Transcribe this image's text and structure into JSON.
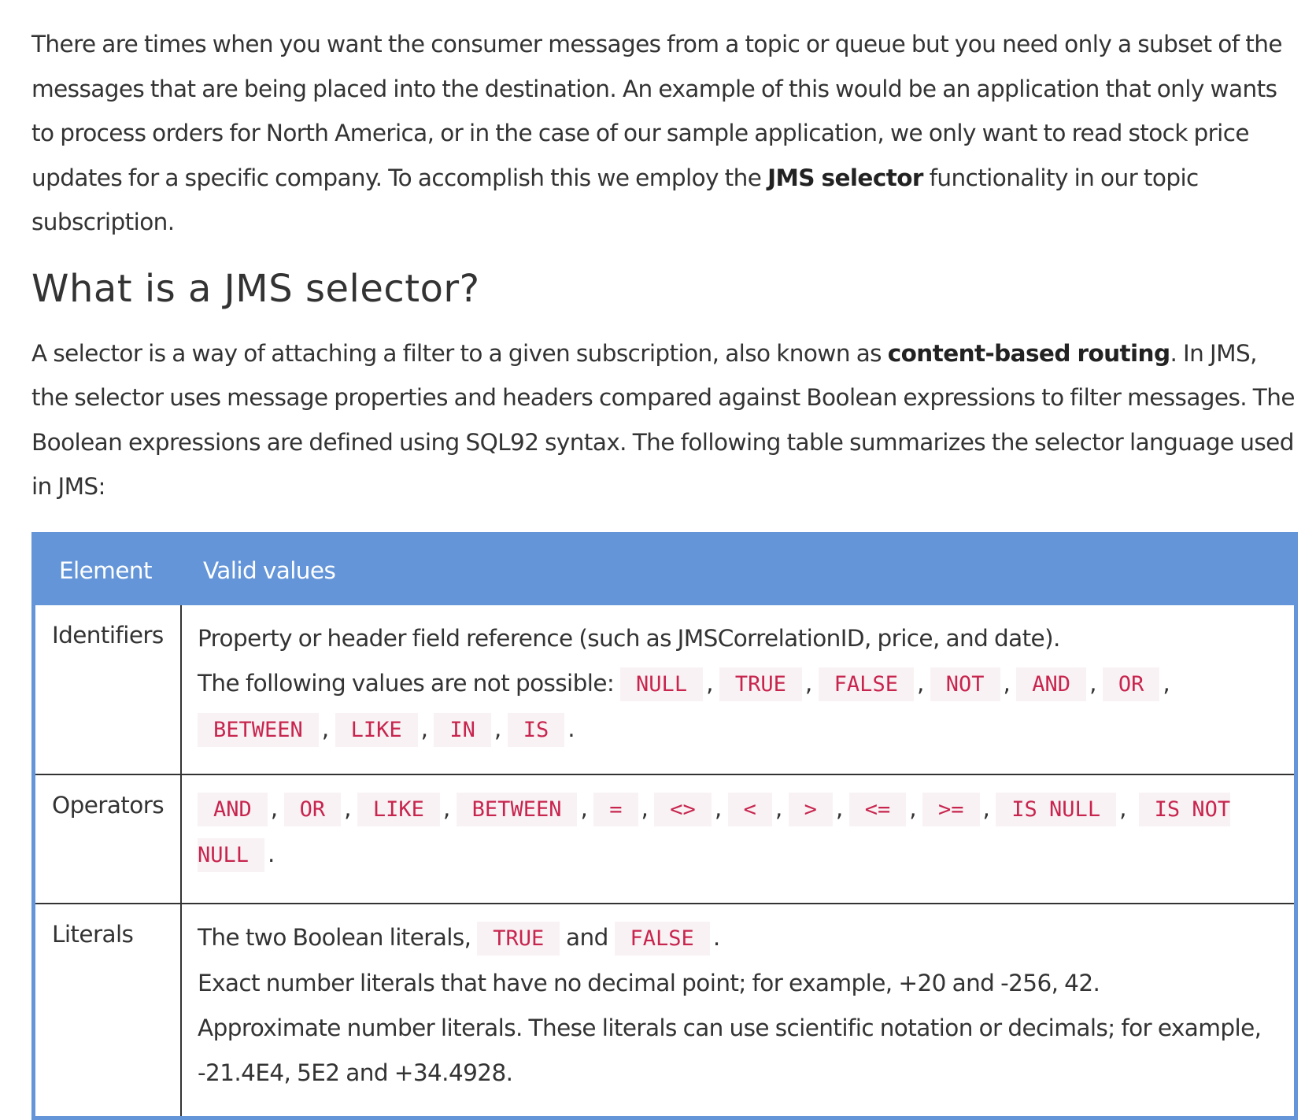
{
  "intro": {
    "text_before": "There are times when you want the consumer messages from a topic or queue but you need only a subset of the messages that are being placed into the destination. An example of this would be an application that only wants to process orders for North America, or in the case of our sample application, we only want to read stock price updates for a specific company. To accomplish this we employ the ",
    "bold": "JMS selector",
    "text_after": " functionality in our topic subscription."
  },
  "heading": "What is a JMS selector?",
  "description": {
    "text_before": "A selector is a way of attaching a filter to a given subscription, also known as ",
    "bold": "content-based routing",
    "text_after": ". In JMS, the selector uses message properties and headers compared against Boolean expressions to filter messages. The Boolean expressions are defined using SQL92 syntax. The following table summarizes the selector language used in JMS:"
  },
  "table": {
    "header": {
      "col1": "Element",
      "col2": "Valid values"
    },
    "identifiers": {
      "label": "Identifiers",
      "line1": "Property or header field reference (such as JMSCorrelationID, price, and date).",
      "line2_prefix": "The following values are not possible: ",
      "codes": [
        "NULL",
        "TRUE",
        "FALSE",
        "NOT",
        "AND",
        "OR",
        "BETWEEN",
        "LIKE",
        "IN",
        "IS"
      ]
    },
    "operators": {
      "label": "Operators",
      "codes": [
        "AND",
        "OR",
        "LIKE",
        "BETWEEN",
        "=",
        "<>",
        "<",
        ">",
        "<=",
        ">=",
        "IS NULL",
        "IS NOT NULL"
      ]
    },
    "literals": {
      "label": "Literals",
      "line1_prefix": "The two Boolean literals, ",
      "code1": "TRUE",
      "and_word": " and ",
      "code2": "FALSE",
      "line2": "Exact number literals that have no decimal point; for example, +20 and -256, 42.",
      "line3": "Approximate number literals. These literals can use scientific notation or decimals; for example, -21.4E4, 5E2 and +34.4928."
    }
  }
}
